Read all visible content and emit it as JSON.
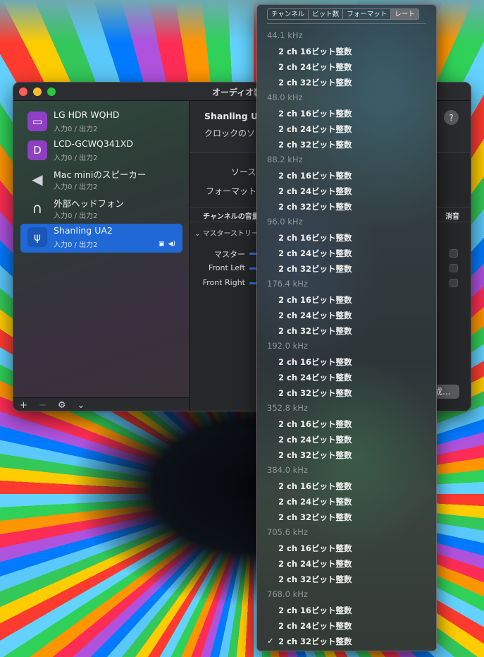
{
  "window": {
    "title": "オーディオ装置"
  },
  "sidebar": {
    "devices": [
      {
        "name": "LG HDR WQHD",
        "io": "入力0 / 出力2",
        "icon": "monitor-icon"
      },
      {
        "name": "LCD-GCWQ341XD",
        "io": "入力0 / 出力2",
        "icon": "displayport-icon"
      },
      {
        "name": "Mac miniのスピーカー",
        "io": "入力0 / 出力2",
        "icon": "speaker-icon"
      },
      {
        "name": "外部ヘッドフォン",
        "io": "入力0 / 出力2",
        "icon": "headphones-icon"
      },
      {
        "name": "Shanling UA2",
        "io": "入力0 / 出力2",
        "icon": "usb-icon",
        "selected": true
      }
    ],
    "toolbar": {
      "add": "+",
      "remove": "−",
      "gear": "⚙",
      "chevron": "⌄"
    }
  },
  "main": {
    "device_title": "Shanling UA",
    "clock_label": "クロックのソ",
    "help": "?",
    "source_label": "ソース",
    "format_label": "フォーマット",
    "channel_header": "チャンネルの音量",
    "mute_header": "消音",
    "master_stream": "マスターストリー",
    "volume_rows": [
      {
        "label": "マスター"
      },
      {
        "label": "Front Left"
      },
      {
        "label": "Front Right"
      }
    ],
    "config_button": "成..."
  },
  "menu": {
    "segments": [
      {
        "label": "チャンネル",
        "active": false
      },
      {
        "label": "ビット数",
        "active": false
      },
      {
        "label": "フォーマット",
        "active": false
      },
      {
        "label": "レート",
        "active": true
      }
    ],
    "groups": [
      {
        "rate": "44.1 kHz",
        "items": [
          "2 ch 16ビット整数",
          "2 ch 24ビット整数",
          "2 ch 32ビット整数"
        ]
      },
      {
        "rate": "48.0 kHz",
        "items": [
          "2 ch 16ビット整数",
          "2 ch 24ビット整数",
          "2 ch 32ビット整数"
        ]
      },
      {
        "rate": "88.2 kHz",
        "items": [
          "2 ch 16ビット整数",
          "2 ch 24ビット整数",
          "2 ch 32ビット整数"
        ]
      },
      {
        "rate": "96.0 kHz",
        "items": [
          "2 ch 16ビット整数",
          "2 ch 24ビット整数",
          "2 ch 32ビット整数"
        ]
      },
      {
        "rate": "176.4 kHz",
        "items": [
          "2 ch 16ビット整数",
          "2 ch 24ビット整数",
          "2 ch 32ビット整数"
        ]
      },
      {
        "rate": "192.0 kHz",
        "items": [
          "2 ch 16ビット整数",
          "2 ch 24ビット整数",
          "2 ch 32ビット整数"
        ]
      },
      {
        "rate": "352.8 kHz",
        "items": [
          "2 ch 16ビット整数",
          "2 ch 24ビット整数",
          "2 ch 32ビット整数"
        ]
      },
      {
        "rate": "384.0 kHz",
        "items": [
          "2 ch 16ビット整数",
          "2 ch 24ビット整数",
          "2 ch 32ビット整数"
        ]
      },
      {
        "rate": "705.6 kHz",
        "items": [
          "2 ch 16ビット整数",
          "2 ch 24ビット整数",
          "2 ch 32ビット整数"
        ]
      },
      {
        "rate": "768.0 kHz",
        "items": [
          "2 ch 16ビット整数",
          "2 ch 24ビット整数",
          "2 ch 32ビット整数"
        ]
      }
    ],
    "selected": {
      "group": 9,
      "item": 2
    },
    "check": "✓"
  },
  "colors": {
    "accent": "#1f68d6",
    "close": "#ff5f57",
    "minimize": "#febc2e",
    "zoom": "#28c840"
  }
}
